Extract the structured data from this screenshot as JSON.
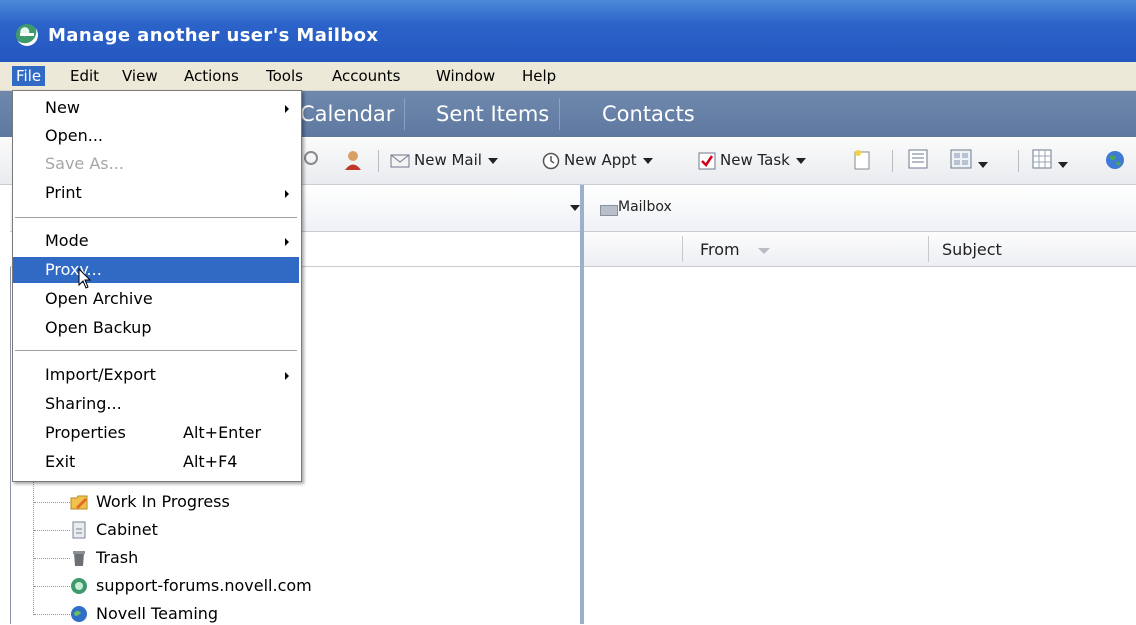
{
  "window": {
    "title": "Manage another user's Mailbox"
  },
  "menubar": [
    "File",
    "Edit",
    "View",
    "Actions",
    "Tools",
    "Accounts",
    "Window",
    "Help"
  ],
  "nav_tabs": [
    "Calendar",
    "Sent Items",
    "Contacts"
  ],
  "toolbar": {
    "new_mail": "New Mail",
    "new_appt": "New Appt",
    "new_task": "New Task"
  },
  "mailbox": {
    "label": "Mailbox",
    "columns": {
      "from": "From",
      "subject": "Subject"
    }
  },
  "file_menu": {
    "items": [
      {
        "label": "New",
        "submenu": true
      },
      {
        "label": "Open..."
      },
      {
        "label": "Save As...",
        "disabled": true
      },
      {
        "label": "Print",
        "submenu": true
      },
      {
        "label": "Mode",
        "submenu": true
      },
      {
        "label": "Proxy...",
        "highlighted": true
      },
      {
        "label": "Open Archive"
      },
      {
        "label": "Open Backup"
      },
      {
        "label": "Import/Export",
        "submenu": true
      },
      {
        "label": "Sharing..."
      },
      {
        "label": "Properties",
        "accelerator": "Alt+Enter"
      },
      {
        "label": "Exit",
        "accelerator": "Alt+F4"
      }
    ]
  },
  "folder_tree": [
    {
      "label": "Work In Progress",
      "icon": "folder-edit-icon"
    },
    {
      "label": "Cabinet",
      "icon": "cabinet-icon"
    },
    {
      "label": "Trash",
      "icon": "trash-icon"
    },
    {
      "label": "support-forums.novell.com",
      "icon": "newsgroup-icon"
    },
    {
      "label": "Novell Teaming",
      "icon": "teaming-icon"
    }
  ],
  "colors": {
    "titlebar": "#2456bf",
    "menu_highlight": "#316ac5",
    "nav_band": "#6f89ad"
  }
}
